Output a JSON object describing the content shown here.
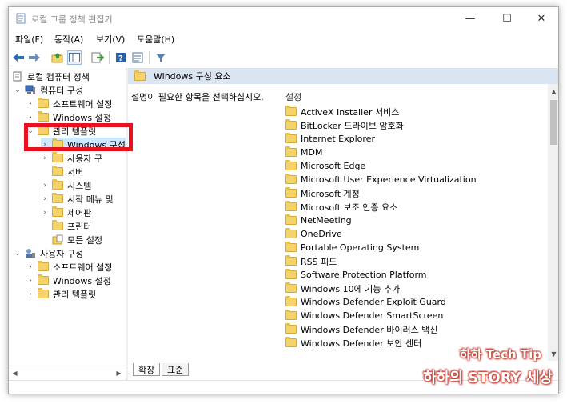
{
  "window": {
    "title": "로컬 그룹 정책 편집기"
  },
  "title_buttons": {
    "minimize": "—",
    "maximize": "☐",
    "close": "✕"
  },
  "menu": [
    {
      "label": "파일(F)"
    },
    {
      "label": "동작(A)"
    },
    {
      "label": "보기(V)"
    },
    {
      "label": "도움말(H)"
    }
  ],
  "toolbar": {
    "icons": [
      "back-arrow-icon",
      "forward-arrow-icon",
      "up-folder-icon",
      "show-hide-tree-icon",
      "export-icon",
      "help-icon",
      "properties-icon",
      "filter-icon"
    ]
  },
  "tree": {
    "root": "로컬 컴퓨터 정책",
    "computer_config": "컴퓨터 구성",
    "c_software": "소프트웨어 설정",
    "c_windows": "Windows 설정",
    "c_admin": "관리 템플릿",
    "c_windows_components": "Windows 구성",
    "c_printers_partial": "사용자 구",
    "c_server": "서버",
    "c_system": "시스템",
    "c_start_menu": "시작 메뉴 및",
    "c_control_panel": "제어판",
    "c_printer": "프린터",
    "c_all_settings": "모든 설정",
    "user_config": "사용자 구성",
    "u_software": "소프트웨어 설정",
    "u_windows": "Windows 설정",
    "u_admin": "관리 템플릿"
  },
  "right": {
    "header": "Windows 구성 요소",
    "description": "설명이 필요한 항목을 선택하십시오.",
    "column_header": "설정",
    "items": [
      "ActiveX Installer 서비스",
      "BitLocker 드라이브 암호화",
      "Internet Explorer",
      "MDM",
      "Microsoft Edge",
      "Microsoft User Experience Virtualization",
      "Microsoft 계정",
      "Microsoft 보조 인증 요소",
      "NetMeeting",
      "OneDrive",
      "Portable Operating System",
      "RSS 피드",
      "Software Protection Platform",
      "Windows 10에 기능 추가",
      "Windows Defender Exploit Guard",
      "Windows Defender SmartScreen",
      "Windows Defender 바이러스 백신",
      "Windows Defender 보안 센터"
    ]
  },
  "tabs": {
    "extended": "확장",
    "standard": "표준"
  },
  "watermark": {
    "line1": "하하 Tech Tip",
    "line2": "하하의 STORY 세상"
  },
  "colors": {
    "header_bg": "#dbe5f1",
    "highlight": "#e8121e",
    "folder": "#f4d36a",
    "watermark": "#c3362b"
  }
}
